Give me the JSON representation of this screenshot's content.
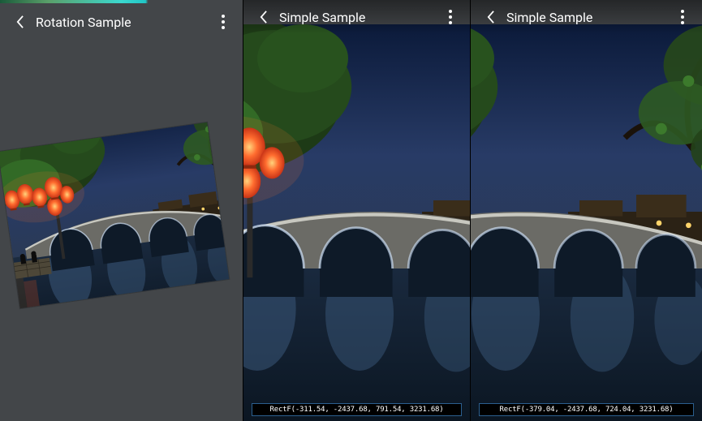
{
  "panels": [
    {
      "title": "Rotation Sample",
      "status": ""
    },
    {
      "title": "Simple Sample",
      "status": "RectF(-311.54, -2437.68, 791.54, 3231.68)"
    },
    {
      "title": "Simple Sample",
      "status": "RectF(-379.04, -2437.68, 724.04, 3231.68)"
    }
  ]
}
